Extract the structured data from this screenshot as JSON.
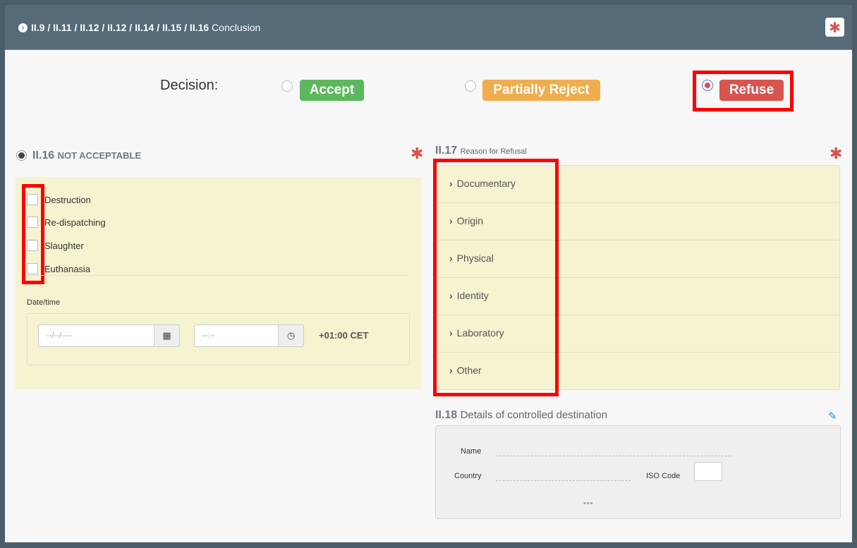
{
  "header": {
    "path": "II.9 / II.11 / II.12 / II.12 / II.14 / II.15 / II.16",
    "title": "Conclusion",
    "required_symbol": "✱"
  },
  "decision": {
    "label": "Decision:",
    "options": [
      {
        "label": "Accept",
        "selected": false,
        "color": "#5cb85c"
      },
      {
        "label": "Partially Reject",
        "selected": false,
        "color": "#f0ad4e"
      },
      {
        "label": "Refuse",
        "selected": true,
        "color": "#d9534f"
      }
    ]
  },
  "not_acceptable": {
    "code": "II.16",
    "title": "NOT ACCEPTABLE",
    "required_symbol": "✱",
    "options": [
      "Destruction",
      "Re-dispatching",
      "Slaughter",
      "Euthanasia"
    ],
    "datetime_label": "Date/time",
    "date_placeholder": "--/--/----",
    "time_placeholder": "--:--",
    "timezone": "+01:00 CET"
  },
  "refusal_reason": {
    "code": "II.17",
    "title": "Reason for Refusal",
    "required_symbol": "✱",
    "items": [
      "Documentary",
      "Origin",
      "Physical",
      "Identity",
      "Laboratory",
      "Other"
    ]
  },
  "controlled_destination": {
    "code": "II.18",
    "title": "Details of controlled destination",
    "name_label": "Name",
    "country_label": "Country",
    "iso_label": "ISO Code",
    "more": "•••"
  },
  "colors": {
    "highlight": "#ff0000",
    "panel_yellow": "#f5f3d0",
    "header_bg": "#566a78"
  }
}
